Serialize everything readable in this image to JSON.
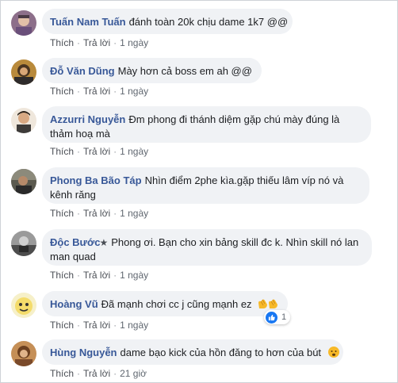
{
  "actions": {
    "like": "Thích",
    "reply": "Trả lời"
  },
  "comments": [
    {
      "author": "Tuấn Nam Tuấn",
      "text": "đánh toàn 20k chịu dame 1k7 @@",
      "time": "1 ngày"
    },
    {
      "author": "Đỗ Văn Dũng",
      "text": "Mày hơn cả boss em ah @@",
      "time": "1 ngày"
    },
    {
      "author": "Azzurri Nguyễn",
      "text_line1": "Đm phong đi thánh diệm gặp chú mày đúng là",
      "text_line2": "thảm hoạ mà",
      "time": "1 ngày"
    },
    {
      "author": "Phong Ba Bão Táp",
      "text_line1": "Nhìn điểm 2phe kìa.gặp thiếu lâm víp nó và",
      "text_line2": "kênh răng",
      "time": "1 ngày"
    },
    {
      "author": "Độc Bước",
      "badge_icon": "star-icon",
      "text_line1": "Phong ơi. Bạn cho xin bảng skill đc k. Nhìn skill nó lan",
      "text_line2": "man quad",
      "time": "1 ngày"
    },
    {
      "author": "Hoàng Vũ",
      "text": "Đã mạnh chơi cc j cũng mạnh ez",
      "emoji": "clapping-hands-icon",
      "reaction_icon": "like-icon",
      "reaction_count": "1",
      "time": "1 ngày"
    },
    {
      "author": "Hùng Nguyễn",
      "text": "dame bạo kick của hồn đăng to hơn của bút",
      "emoji": "sad-face-icon",
      "time": "21 giờ"
    }
  ],
  "colors": {
    "author": "#385898",
    "bubble": "#f0f2f5",
    "meta": "#606770",
    "reaction": "#1877f2"
  }
}
